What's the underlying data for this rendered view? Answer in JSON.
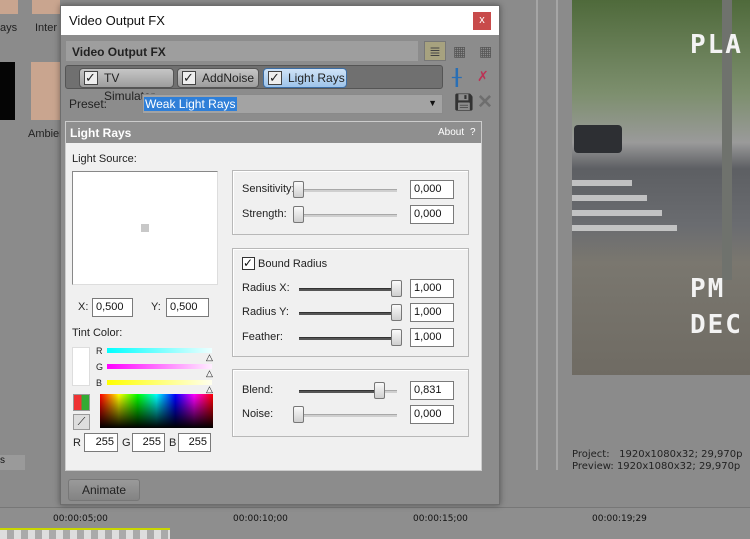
{
  "background": {
    "media_labels": [
      "ays",
      "Inter",
      "Ambier"
    ],
    "preview_overlay": [
      "PLA",
      "PM",
      "DEC"
    ],
    "status": {
      "project_label": "Project:",
      "project_value": "1920x1080x32; 29,970p",
      "preview_label": "Preview:",
      "preview_value": "1920x1080x32; 29,970p"
    },
    "timeline": {
      "ticks": [
        "00:00:05;00",
        "00:00:10;00",
        "00:00:15;00",
        "00:00:19;29"
      ]
    },
    "left_tab_fragment": "s"
  },
  "dialog": {
    "title": "Video Output FX",
    "close_label": "x",
    "header_title": "Video Output FX",
    "chain": [
      {
        "label": "TV Simulator",
        "checked": true,
        "selected": false
      },
      {
        "label": "AddNoise",
        "checked": true,
        "selected": false
      },
      {
        "label": "Light Rays",
        "checked": true,
        "selected": true
      }
    ],
    "preset_label": "Preset:",
    "preset_value": "Weak Light Rays",
    "plugin": {
      "title": "Light Rays",
      "about": "About",
      "help": "?",
      "light_source_label": "Light Source:",
      "x_label": "X:",
      "x_value": "0,500",
      "y_label": "Y:",
      "y_value": "0,500",
      "tint_label": "Tint Color:",
      "tint": {
        "r_label": "R",
        "g_label": "G",
        "b_label": "B",
        "r": "255",
        "g": "255",
        "b": "255",
        "color": "#ffffff"
      },
      "sensitivity": {
        "label": "Sensitivity:",
        "value": "0,000",
        "fraction": 0
      },
      "strength": {
        "label": "Strength:",
        "value": "0,000",
        "fraction": 0
      },
      "bound_radius": {
        "label": "Bound Radius",
        "checked": true
      },
      "radius_x": {
        "label": "Radius X:",
        "value": "1,000",
        "fraction": 1
      },
      "radius_y": {
        "label": "Radius Y:",
        "value": "1,000",
        "fraction": 1
      },
      "feather": {
        "label": "Feather:",
        "value": "1,000",
        "fraction": 1
      },
      "blend": {
        "label": "Blend:",
        "value": "0,831",
        "fraction": 0.831
      },
      "noise": {
        "label": "Noise:",
        "value": "0,000",
        "fraction": 0
      }
    },
    "animate_label": "Animate"
  }
}
